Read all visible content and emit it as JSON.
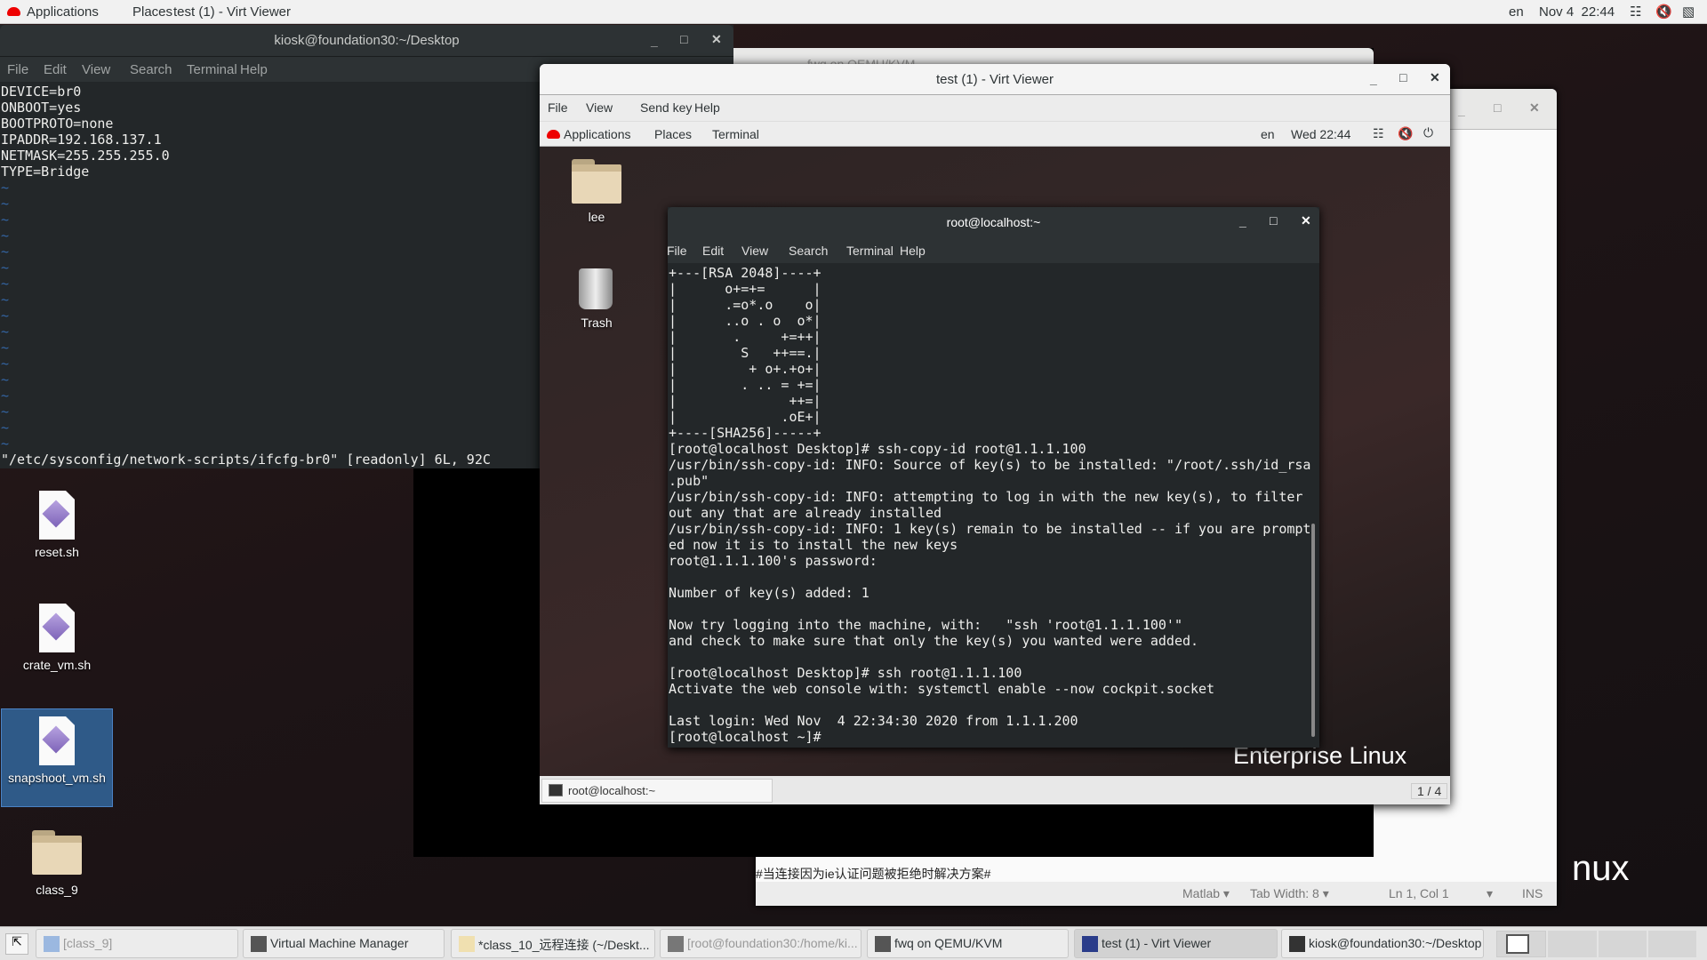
{
  "topbar": {
    "applications": "Applications",
    "places": "Places",
    "active_window": "test (1) - Virt Viewer",
    "lang": "en",
    "clock": "Nov 4  22:44",
    "icons": [
      "network-icon",
      "volume-muted-icon",
      "battery-icon"
    ]
  },
  "host_terminal": {
    "title": "kiosk@foundation30:~/Desktop",
    "menu": [
      "File",
      "Edit",
      "View",
      "Search",
      "Terminal",
      "Help"
    ],
    "lines": [
      "DEVICE=br0",
      "ONBOOT=yes",
      "BOOTPROTO=none",
      "IPADDR=192.168.137.1",
      "NETMASK=255.255.255.0",
      "TYPE=Bridge",
      "~",
      "~",
      "~",
      "~",
      "~",
      "~",
      "~",
      "~",
      "~",
      "~",
      "~",
      "~",
      "~",
      "~",
      "~",
      "~",
      "~"
    ],
    "status": "\"/etc/sysconfig/network-scripts/ifcfg-br0\" [readonly] 6L, 92C"
  },
  "background_window": {
    "title": "fwq on QEMU/KVM"
  },
  "editor": {
    "text_line": "#当连接因为ie认证问题被拒绝时解决方案#",
    "language": "Matlab",
    "tab_width": "Tab Width: 8",
    "position": "Ln 1, Col 1",
    "mode": "INS"
  },
  "wallpaper_text": "nux",
  "desktop_icons": [
    {
      "label": "reset.sh"
    },
    {
      "label": "crate_vm.sh"
    },
    {
      "label": "snapshoot_vm.sh"
    },
    {
      "label": "class_9"
    }
  ],
  "virt_viewer": {
    "title": "test (1) - Virt Viewer",
    "menu": [
      "File",
      "View",
      "Send key",
      "Help"
    ],
    "guest_topbar": {
      "applications": "Applications",
      "places": "Places",
      "terminal": "Terminal",
      "lang": "en",
      "clock": "Wed 22:44"
    },
    "guest_icons": [
      {
        "label": "lee"
      },
      {
        "label": "Trash"
      }
    ],
    "guest_wallpaper_text": "Enterprise Linux",
    "guest_task": "root@localhost:~",
    "workspace": "1 / 4",
    "guest_terminal": {
      "title": "root@localhost:~",
      "menu": [
        "File",
        "Edit",
        "View",
        "Search",
        "Terminal",
        "Help"
      ],
      "lines": [
        "+---[RSA 2048]----+",
        "|      o+=+=      |",
        "|      .=o*.o    o|",
        "|      ..o . o  o*|",
        "|       .     +=++|",
        "|        S   ++==.|",
        "|         + o+.+o+|",
        "|        . .. = +=|",
        "|              ++=|",
        "|             .oE+|",
        "+----[SHA256]-----+",
        "[root@localhost Desktop]# ssh-copy-id root@1.1.1.100",
        "/usr/bin/ssh-copy-id: INFO: Source of key(s) to be installed: \"/root/.ssh/id_rsa",
        ".pub\"",
        "/usr/bin/ssh-copy-id: INFO: attempting to log in with the new key(s), to filter",
        "out any that are already installed",
        "/usr/bin/ssh-copy-id: INFO: 1 key(s) remain to be installed -- if you are prompt",
        "ed now it is to install the new keys",
        "root@1.1.1.100's password: ",
        "",
        "Number of key(s) added: 1",
        "",
        "Now try logging into the machine, with:   \"ssh 'root@1.1.1.100'\"",
        "and check to make sure that only the key(s) you wanted were added.",
        "",
        "[root@localhost Desktop]# ssh root@1.1.1.100",
        "Activate the web console with: systemctl enable --now cockpit.socket",
        "",
        "Last login: Wed Nov  4 22:34:30 2020 from 1.1.1.200",
        "[root@localhost ~]# "
      ]
    }
  },
  "taskbar": {
    "items": [
      "[class_9]",
      "Virtual Machine Manager",
      "*class_10_远程连接 (~/Deskt...",
      "[root@foundation30:/home/ki...",
      "fwq on QEMU/KVM",
      "test (1) - Virt Viewer",
      "kiosk@foundation30:~/Desktop"
    ],
    "active": "test (1) - Virt Viewer"
  }
}
